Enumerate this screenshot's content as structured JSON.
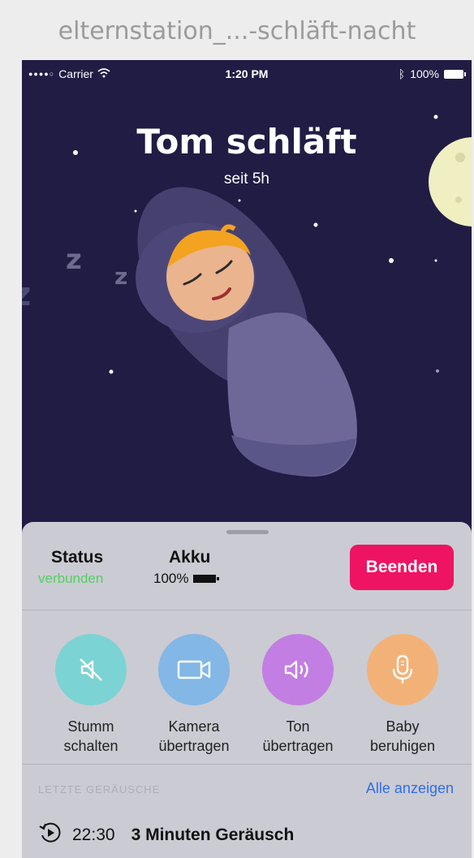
{
  "file_title": "elternstation_...-schläft-nacht",
  "statusbar": {
    "carrier": "Carrier",
    "time": "1:20 PM",
    "battery": "100%"
  },
  "hero": {
    "title": "Tom schläft",
    "subtitle": "seit 5h",
    "sleep_letters": [
      "z",
      "z",
      "z"
    ]
  },
  "panel": {
    "status_label": "Status",
    "status_value": "verbunden",
    "akku_label": "Akku",
    "akku_value": "100%",
    "end_button": "Beenden",
    "actions": [
      {
        "line1": "Stumm",
        "line2": "schalten",
        "color": "#7cd3d4",
        "icon": "mute-icon"
      },
      {
        "line1": "Kamera",
        "line2": "übertragen",
        "color": "#83b7e5",
        "icon": "camera-icon"
      },
      {
        "line1": "Ton",
        "line2": "übertragen",
        "color": "#c27ee2",
        "icon": "speaker-icon"
      },
      {
        "line1": "Baby",
        "line2": "beruhigen",
        "color": "#f2b277",
        "icon": "microphone-icon"
      }
    ],
    "recent_title": "LETZTE GERÄUSCHE",
    "show_all": "Alle anzeigen",
    "recent": [
      {
        "time": "22:30",
        "description": "3 Minuten Geräusch"
      }
    ]
  },
  "colors": {
    "night": "#201c44",
    "end_button": "#ee1463",
    "connected": "#53d064",
    "link": "#2f6fe8"
  }
}
